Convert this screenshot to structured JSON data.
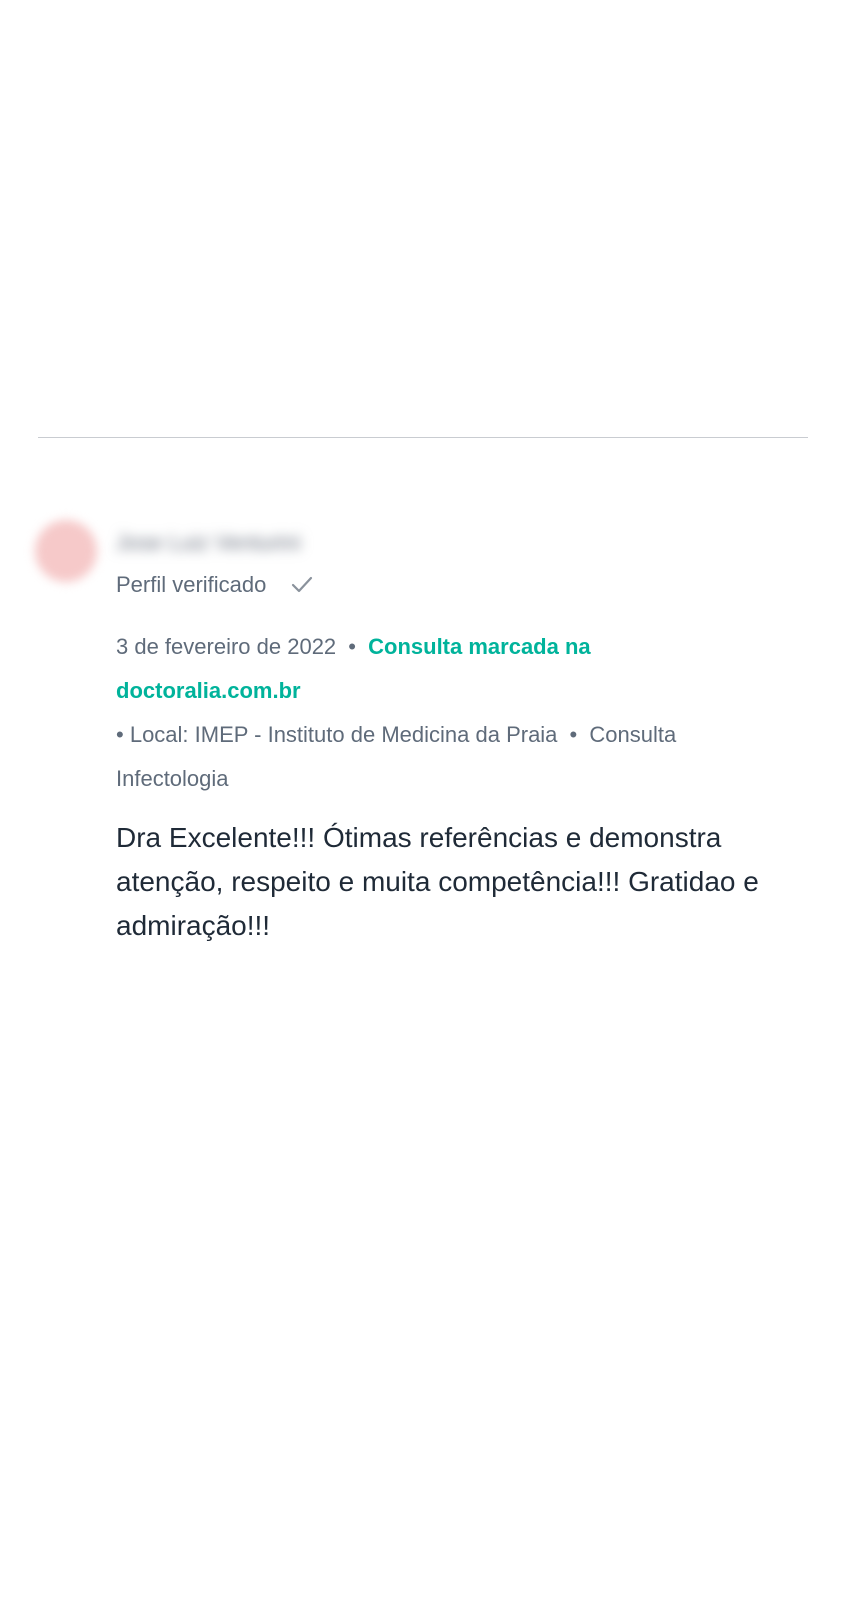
{
  "review": {
    "author_name": "Jose Luiz Venturini",
    "verified_label": "Perfil verificado",
    "date": "3 de fevereiro de 2022",
    "separator": "•",
    "booking_link": "Consulta marcada na doctoralia.com.br",
    "location": "Local: IMEP - Instituto de Medicina da Praia",
    "service": "Consulta Infectologia",
    "text": "Dra Excelente!!! Ótimas referências e demonstra atenção, respeito e muita competência!!! Gratidao e admiração!!!"
  },
  "colors": {
    "accent": "#00b39b",
    "meta_text": "#5f6b7a",
    "body_text": "#1f2a37",
    "divider": "#c9ccd1"
  },
  "icons": {
    "verified": "check-icon"
  }
}
